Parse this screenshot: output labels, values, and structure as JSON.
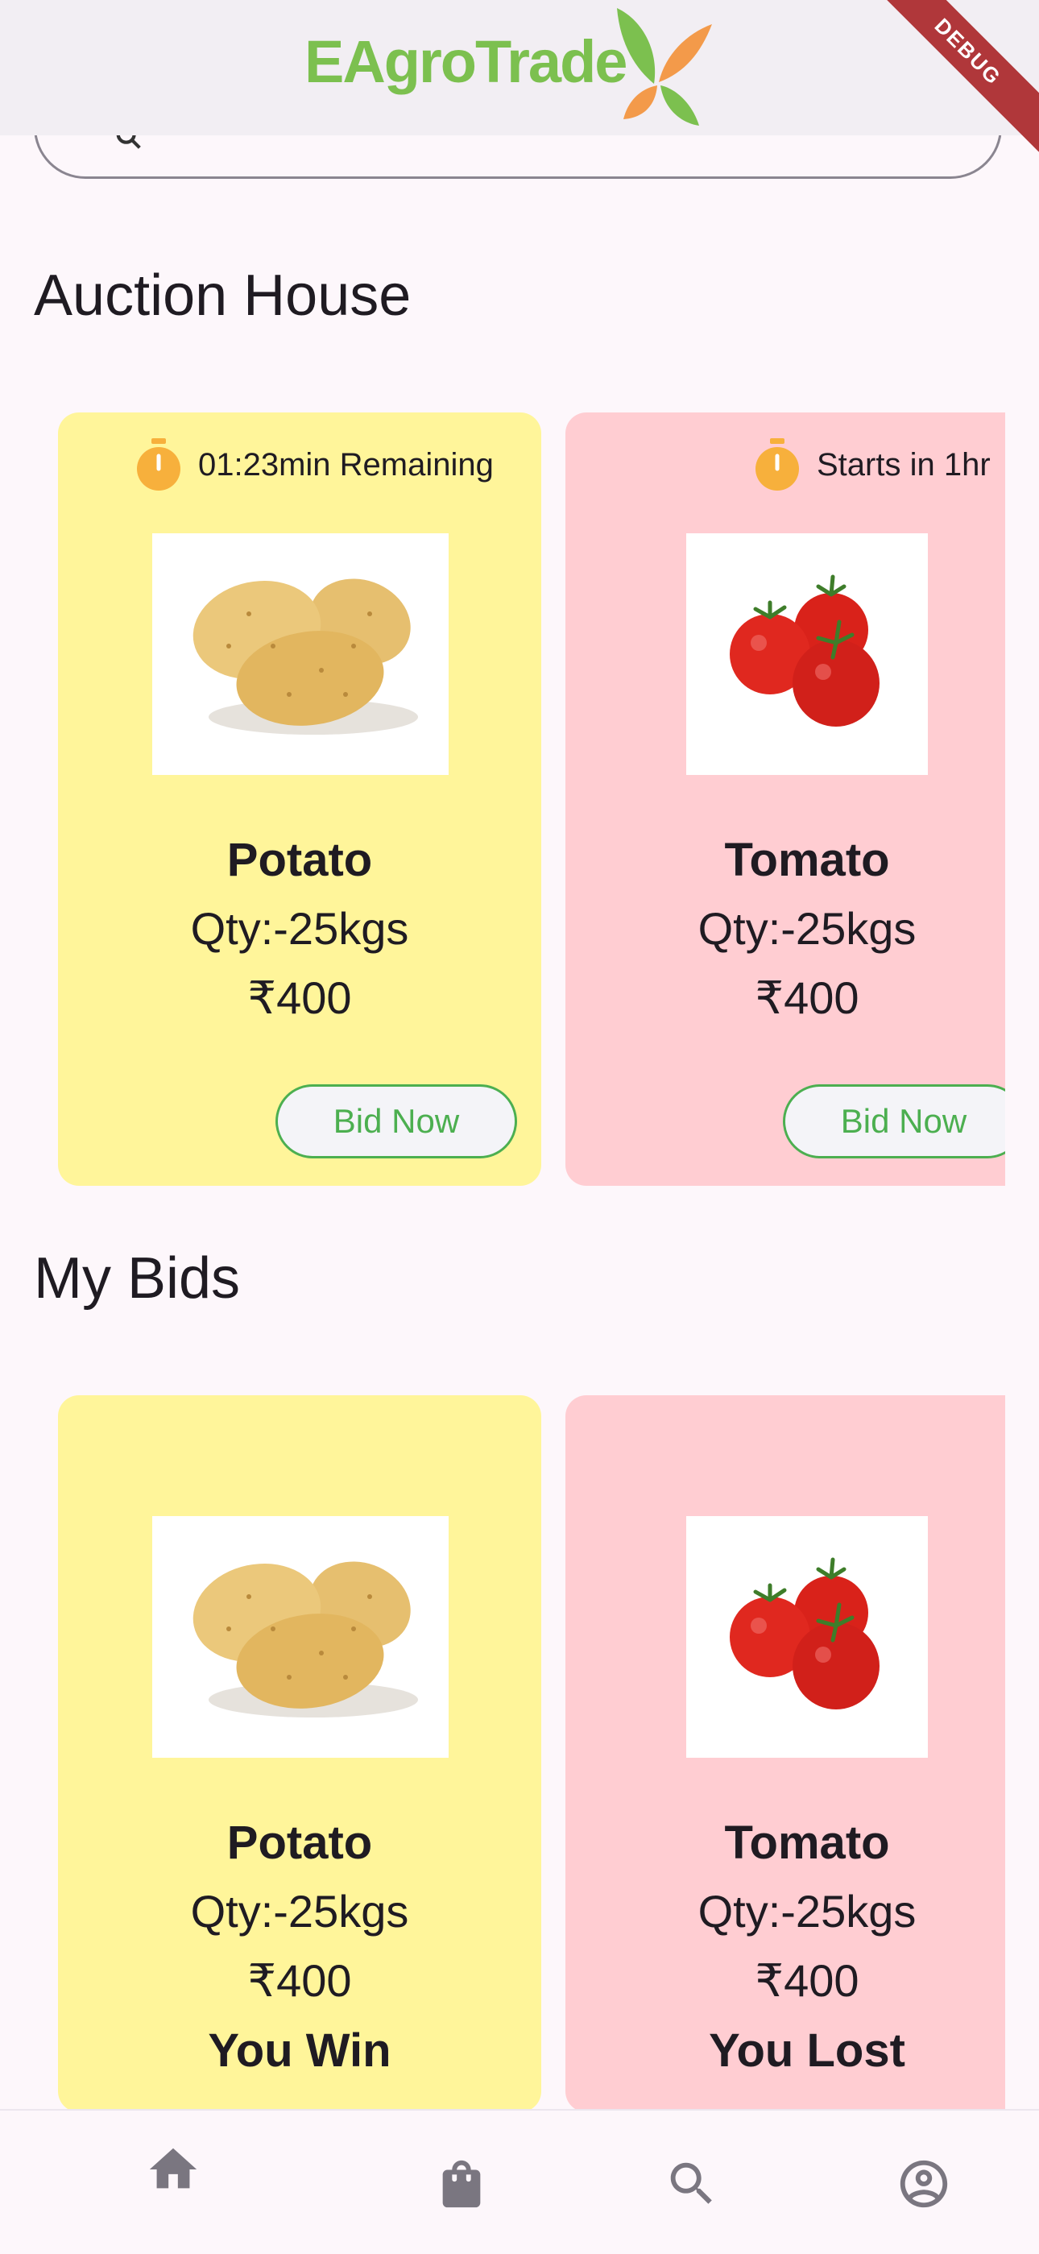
{
  "app": {
    "title": "EAgroTrade",
    "debug_banner": "DEBUG"
  },
  "search": {
    "placeholder": "Search"
  },
  "sections": {
    "auction": "Auction House",
    "my_bids": "My Bids"
  },
  "auction_cards": [
    {
      "timer": "01:23min Remaining",
      "name": "Potato",
      "qty": "Qty:-25kgs",
      "price": "₹400",
      "button": "Bid Now",
      "color": "#fff59a"
    },
    {
      "timer": "Starts in 1hr",
      "name": "Tomato",
      "qty": "Qty:-25kgs",
      "price": "₹400",
      "button": "Bid Now",
      "color": "#ffcdd2"
    }
  ],
  "bid_cards": [
    {
      "name": "Potato",
      "qty": "Qty:-25kgs",
      "price": "₹400",
      "result": "You Win",
      "color": "#fff59a"
    },
    {
      "name": "Tomato",
      "qty": "Qty:-25kgs",
      "price": "₹400",
      "result": "You Lost",
      "color": "#ffcdd2"
    }
  ],
  "bottom_nav": [
    {
      "icon": "home-icon"
    },
    {
      "icon": "shopping-bag-icon"
    },
    {
      "icon": "search-icon"
    },
    {
      "icon": "account-circle-icon"
    }
  ],
  "colors": {
    "accent_green": "#4caf50",
    "logo_green": "#7cc04f",
    "logo_orange": "#f39a4a",
    "timer_orange": "#f7b03c"
  }
}
